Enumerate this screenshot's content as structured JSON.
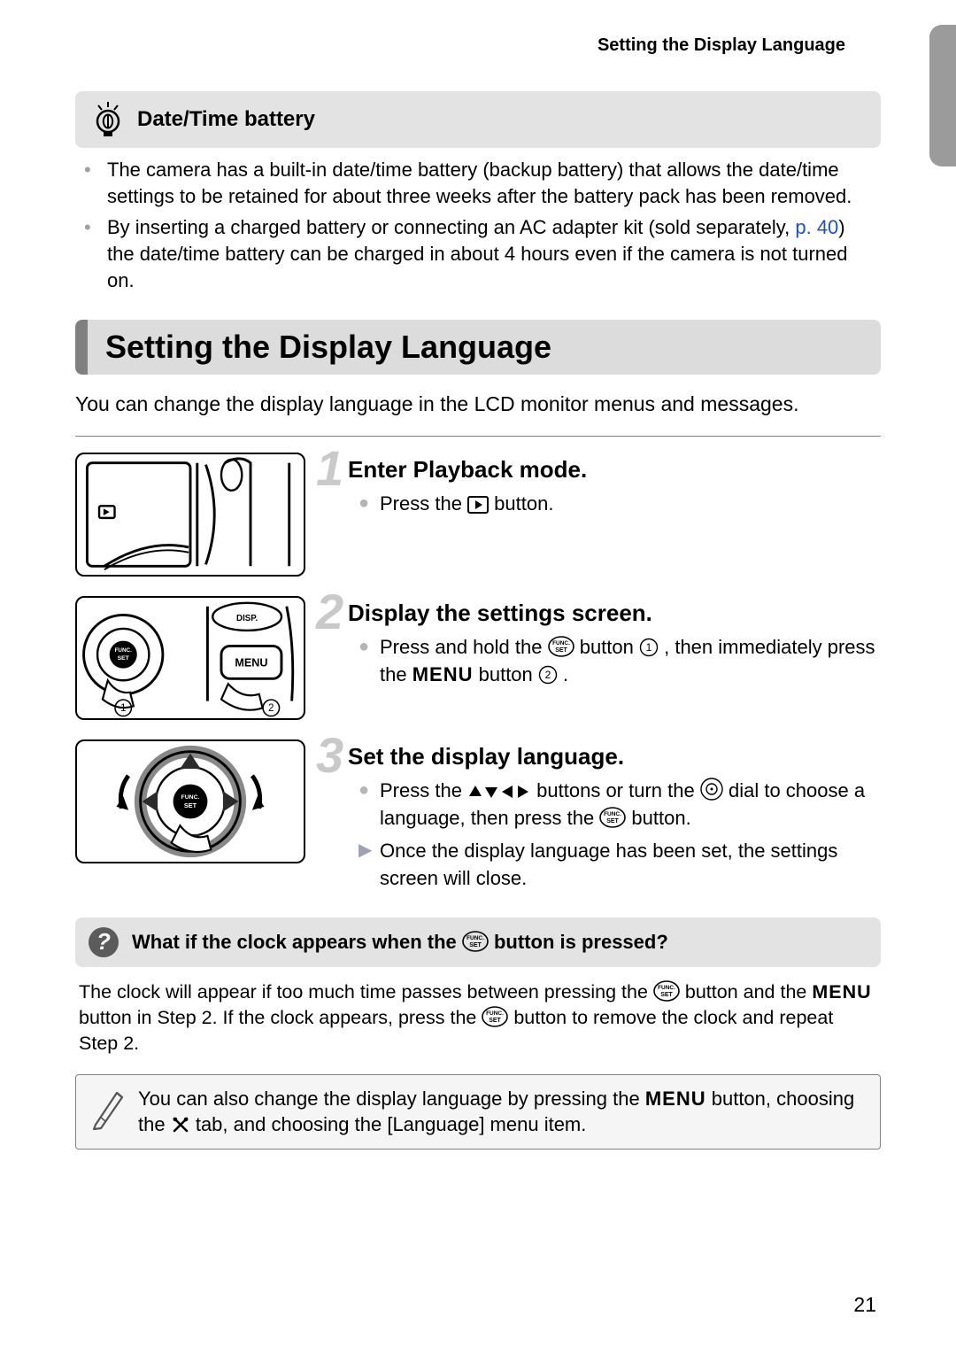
{
  "running_head": "Setting the Display Language",
  "tip": {
    "title": "Date/Time battery",
    "bullets": [
      {
        "text_a": "The camera has a built-in date/time battery (backup battery) that allows the date/time settings to be retained for about three weeks after the battery pack has been removed."
      },
      {
        "text_a": "By inserting a charged battery or connecting an AC adapter kit (sold separately, ",
        "page_ref": "p. 40",
        "text_b": ") the date/time battery can be charged in about 4 hours even if the camera is not turned on."
      }
    ]
  },
  "section_title": "Setting the Display Language",
  "intro": "You can change the display language in the LCD monitor menus and messages.",
  "steps": [
    {
      "num": "1",
      "title": "Enter Playback mode.",
      "lines": [
        {
          "bullet": "circle",
          "pre": "Press the ",
          "post": " button.",
          "icon": "playback"
        }
      ]
    },
    {
      "num": "2",
      "title": "Display the settings screen.",
      "lines": [
        {
          "bullet": "circle",
          "pre": "Press and hold the ",
          "mid1_icon": "funcset",
          "mid1_post": " button ",
          "mid2_icon": "circ1",
          "mid2_post": " , then immediately press the ",
          "mid3_word": "MENU",
          "mid3_post": " button ",
          "mid4_icon": "circ2",
          "post": " ."
        }
      ]
    },
    {
      "num": "3",
      "title": "Set the display language.",
      "lines": [
        {
          "bullet": "circle",
          "pre": "Press the ",
          "mid1_icon": "arrows",
          "mid1_post": " buttons or turn the ",
          "mid2_icon": "dial",
          "mid2_post": " dial to choose a language, then press the ",
          "mid3_icon": "funcset",
          "post": " button."
        },
        {
          "bullet": "tri",
          "pre": "Once the display language has been set, the settings screen will close."
        }
      ]
    }
  ],
  "question": {
    "pre": "What if the clock appears when the ",
    "post": " button is pressed?",
    "body_a": "The clock will appear if too much time passes between pressing the ",
    "body_b": " button and the ",
    "body_menu": "MENU",
    "body_c": " button in Step 2. If the clock appears, press the ",
    "body_d": " button to remove the clock and repeat Step 2."
  },
  "note": {
    "a": "You can also change the display language by pressing the ",
    "menu": "MENU",
    "b": " button, choosing the ",
    "c": " tab, and choosing the [Language] menu item."
  },
  "page_number": "21"
}
